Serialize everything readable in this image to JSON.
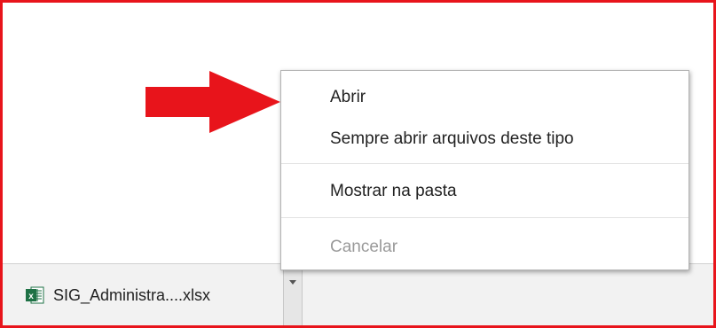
{
  "download": {
    "file_name": "SIG_Administra....xlsx",
    "file_icon": "excel-file-icon",
    "chevron_icon": "chevron-down-icon"
  },
  "context_menu": {
    "items": [
      {
        "label": "Abrir",
        "enabled": true
      },
      {
        "label": "Sempre abrir arquivos deste tipo",
        "enabled": true
      },
      {
        "label": "Mostrar na pasta",
        "enabled": true
      },
      {
        "label": "Cancelar",
        "enabled": false
      }
    ]
  },
  "annotation": {
    "arrow_color": "#e8141b",
    "frame_color": "#e8141b"
  }
}
